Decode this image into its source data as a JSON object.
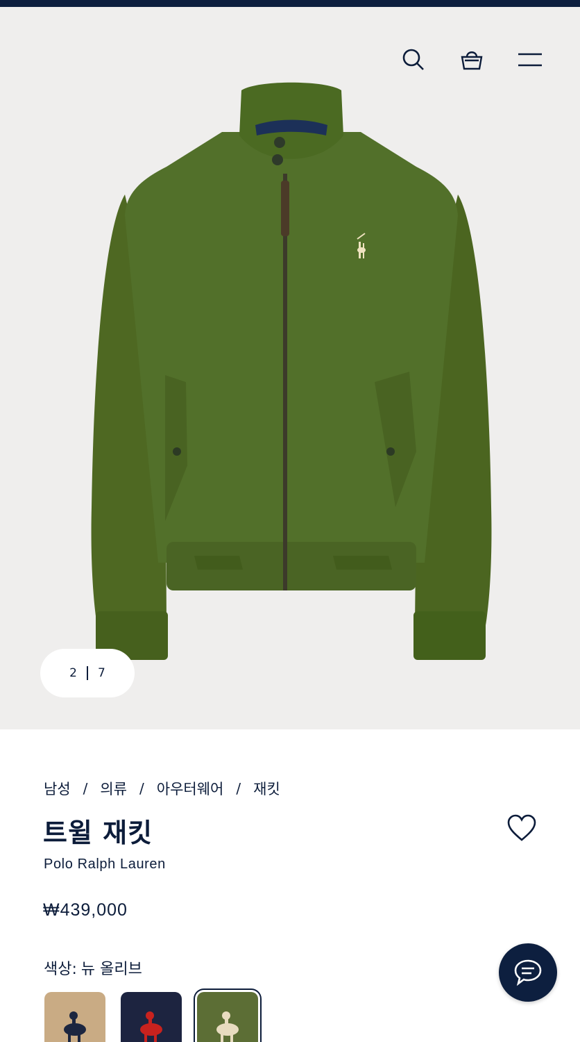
{
  "header": {
    "icons": [
      "search-icon",
      "shopping-bag-icon",
      "menu-icon"
    ]
  },
  "gallery": {
    "current": "2",
    "total": "7"
  },
  "breadcrumb": {
    "items": [
      "남성",
      "의류",
      "아우터웨어",
      "재킷"
    ],
    "separator": "/"
  },
  "product": {
    "title": "트윌 재킷",
    "brand": "Polo Ralph Lauren",
    "price": "₩439,000"
  },
  "color": {
    "label": "색상:",
    "selected": "뉴 올리브",
    "swatches": [
      {
        "name": "tan",
        "bg": "#c9ab84",
        "logo": "#1c2640"
      },
      {
        "name": "navy",
        "bg": "#1d2440",
        "logo": "#c8221e"
      },
      {
        "name": "olive",
        "bg": "#5c6e35",
        "logo": "#e8dcc0"
      }
    ]
  },
  "colors": {
    "brand_navy": "#0d1f3f",
    "hero_bg": "#efeeed",
    "jacket_olive": "#4f6a23"
  }
}
